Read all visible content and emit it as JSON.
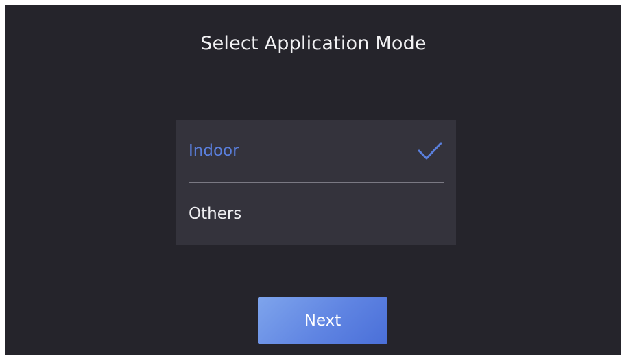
{
  "page": {
    "title": "Select Application Mode"
  },
  "options": [
    {
      "label": "Indoor",
      "selected": true,
      "icon": "checkmark-icon"
    },
    {
      "label": "Others",
      "selected": false
    }
  ],
  "actions": {
    "next_label": "Next"
  },
  "colors": {
    "background": "#25242b",
    "panel": "#34333c",
    "accent": "#5a7fdc",
    "button_gradient_start": "#7ea4ec",
    "button_gradient_end": "#4a6fd8"
  }
}
